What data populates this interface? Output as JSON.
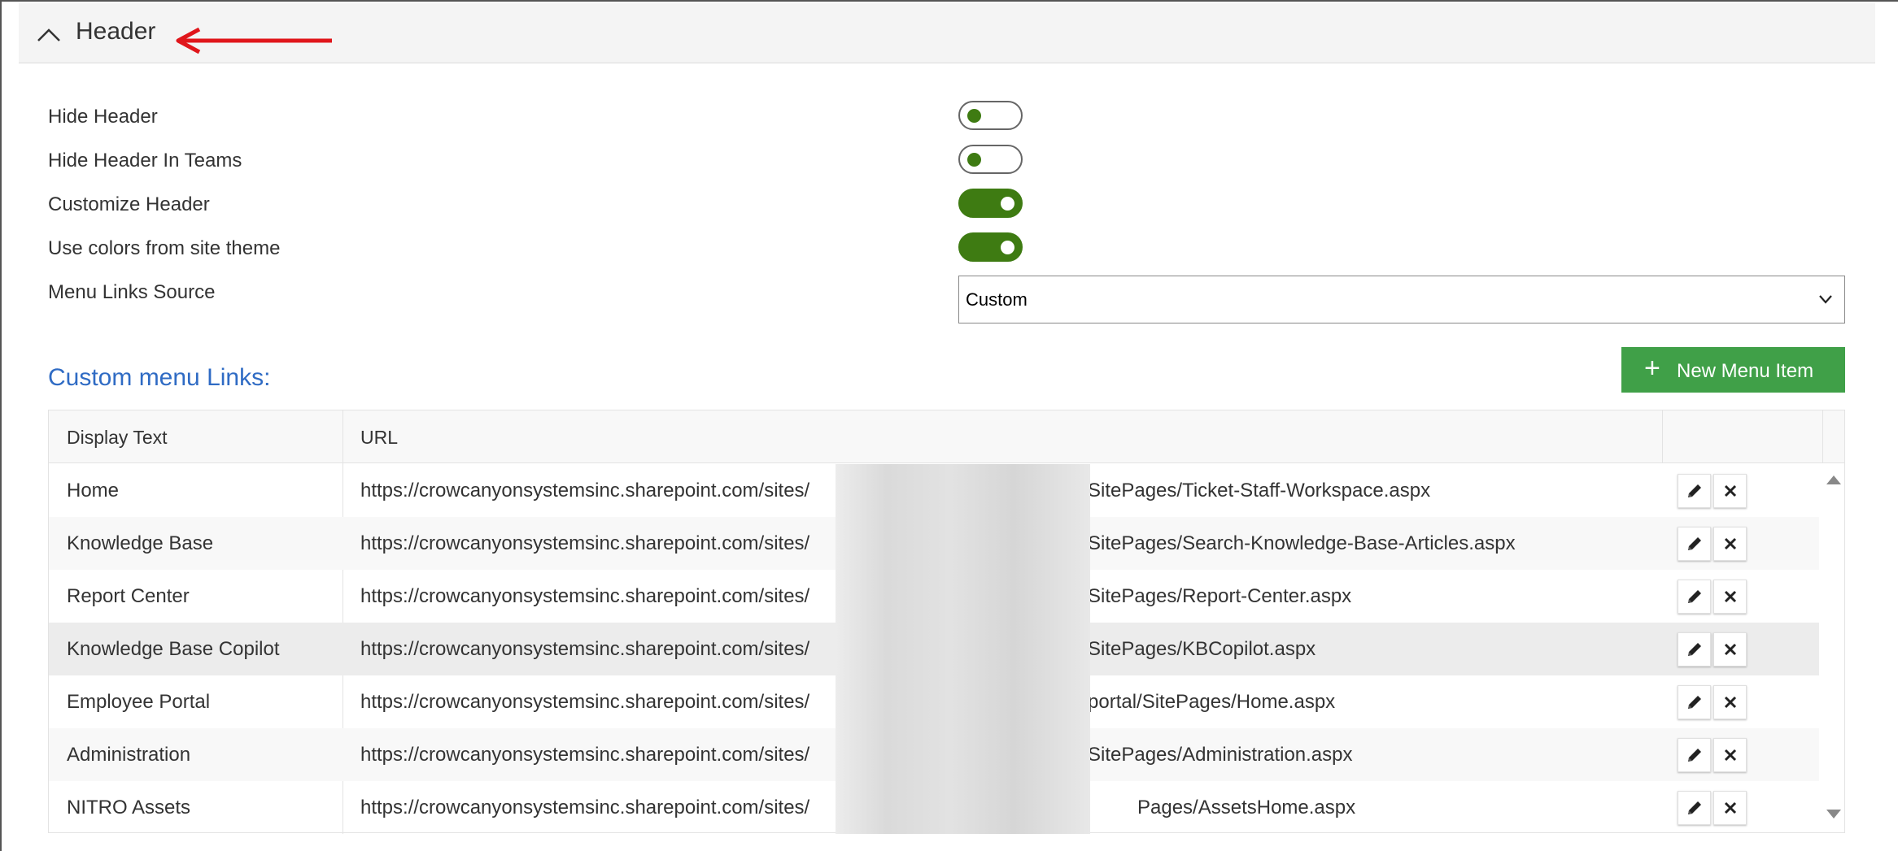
{
  "section": {
    "title": "Header"
  },
  "settings": [
    {
      "label": "Hide Header",
      "on": false
    },
    {
      "label": "Hide Header In Teams",
      "on": false
    },
    {
      "label": "Customize Header",
      "on": true
    },
    {
      "label": "Use colors from site theme",
      "on": true
    },
    {
      "label": "Menu Links Source"
    }
  ],
  "menu_links_source": {
    "value": "Custom"
  },
  "custom_links": {
    "title": "Custom menu Links:",
    "new_button_label": "New Menu Item",
    "columns": [
      "Display Text",
      "URL"
    ],
    "rows": [
      {
        "display": "Home",
        "url_start": "https://crowcanyonsystemsinc.sharepoint.com/sites/",
        "url_end": "SitePages/Ticket-Staff-Workspace.aspx"
      },
      {
        "display": "Knowledge Base",
        "url_start": "https://crowcanyonsystemsinc.sharepoint.com/sites/",
        "url_end": "SitePages/Search-Knowledge-Base-Articles.aspx"
      },
      {
        "display": "Report Center",
        "url_start": "https://crowcanyonsystemsinc.sharepoint.com/sites/",
        "url_end": "SitePages/Report-Center.aspx"
      },
      {
        "display": "Knowledge Base Copilot",
        "url_start": "https://crowcanyonsystemsinc.sharepoint.com/sites/",
        "url_end": "SitePages/KBCopilot.aspx"
      },
      {
        "display": "Employee Portal",
        "url_start": "https://crowcanyonsystemsinc.sharepoint.com/sites/",
        "url_end": "portal/SitePages/Home.aspx"
      },
      {
        "display": "Administration",
        "url_start": "https://crowcanyonsystemsinc.sharepoint.com/sites/",
        "url_end": "SitePages/Administration.aspx"
      },
      {
        "display": "NITRO Assets",
        "url_start": "https://crowcanyonsystemsinc.sharepoint.com/sites/",
        "url_end": "Pages/AssetsHome.aspx"
      }
    ]
  },
  "colors": {
    "toggle_on": "#3e7b12",
    "primary_button": "#40a048",
    "link_title": "#2f6bc4",
    "annotation_arrow": "#e0161b"
  },
  "icons": {
    "collapse": "chevron-up-icon",
    "add": "plus-icon",
    "edit": "pencil-icon",
    "delete": "close-icon",
    "dropdown": "chevron-down-icon"
  }
}
